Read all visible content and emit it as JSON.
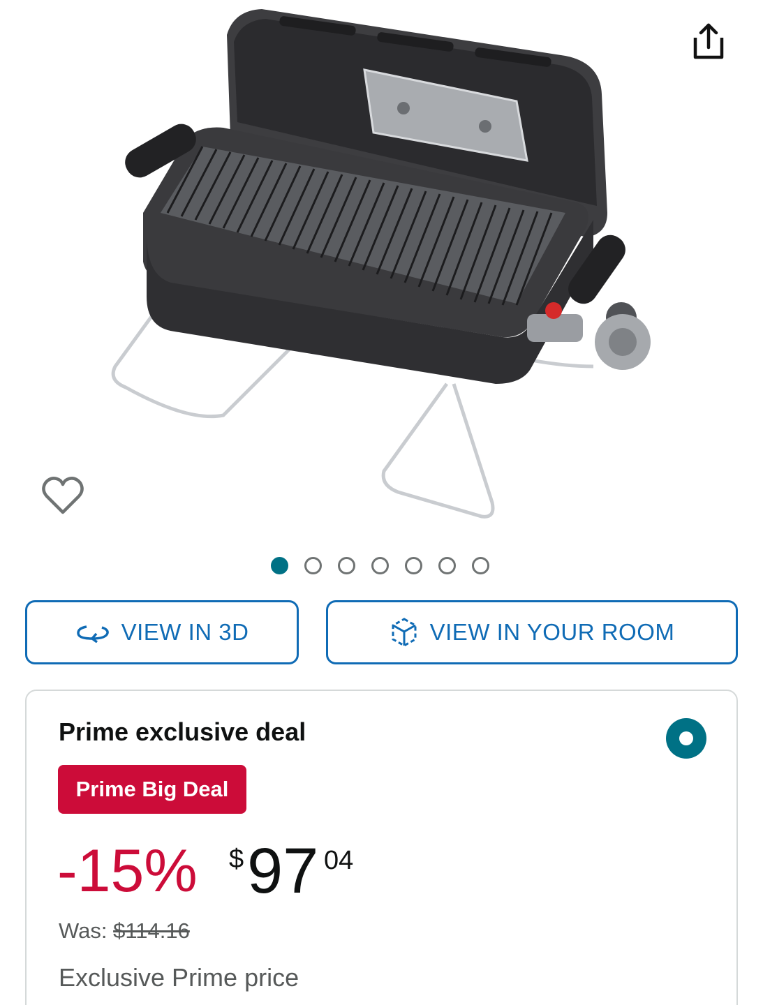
{
  "product": {
    "image_alt": "Portable gas grill with lid open",
    "share_icon": "share-icon",
    "wishlist_icon": "heart-icon"
  },
  "carousel": {
    "total": 7,
    "active_index": 0
  },
  "buttons": {
    "view_3d_label": "VIEW IN 3D",
    "view_3d_icon": "rotate-3d-icon",
    "view_room_label": "VIEW IN YOUR ROOM",
    "view_room_icon": "ar-cube-icon"
  },
  "deal": {
    "title": "Prime exclusive deal",
    "badge": "Prime Big Deal",
    "discount": "-15%",
    "currency_symbol": "$",
    "price_whole": "97",
    "price_fraction": "04",
    "was_label": "Was:",
    "was_price": "$114.16",
    "exclusive_text": "Exclusive Prime price",
    "selected": true
  },
  "colors": {
    "accent_teal": "#007185",
    "link_blue": "#0f6bb5",
    "deal_red": "#cc0c39",
    "secondary_text": "#565959"
  }
}
